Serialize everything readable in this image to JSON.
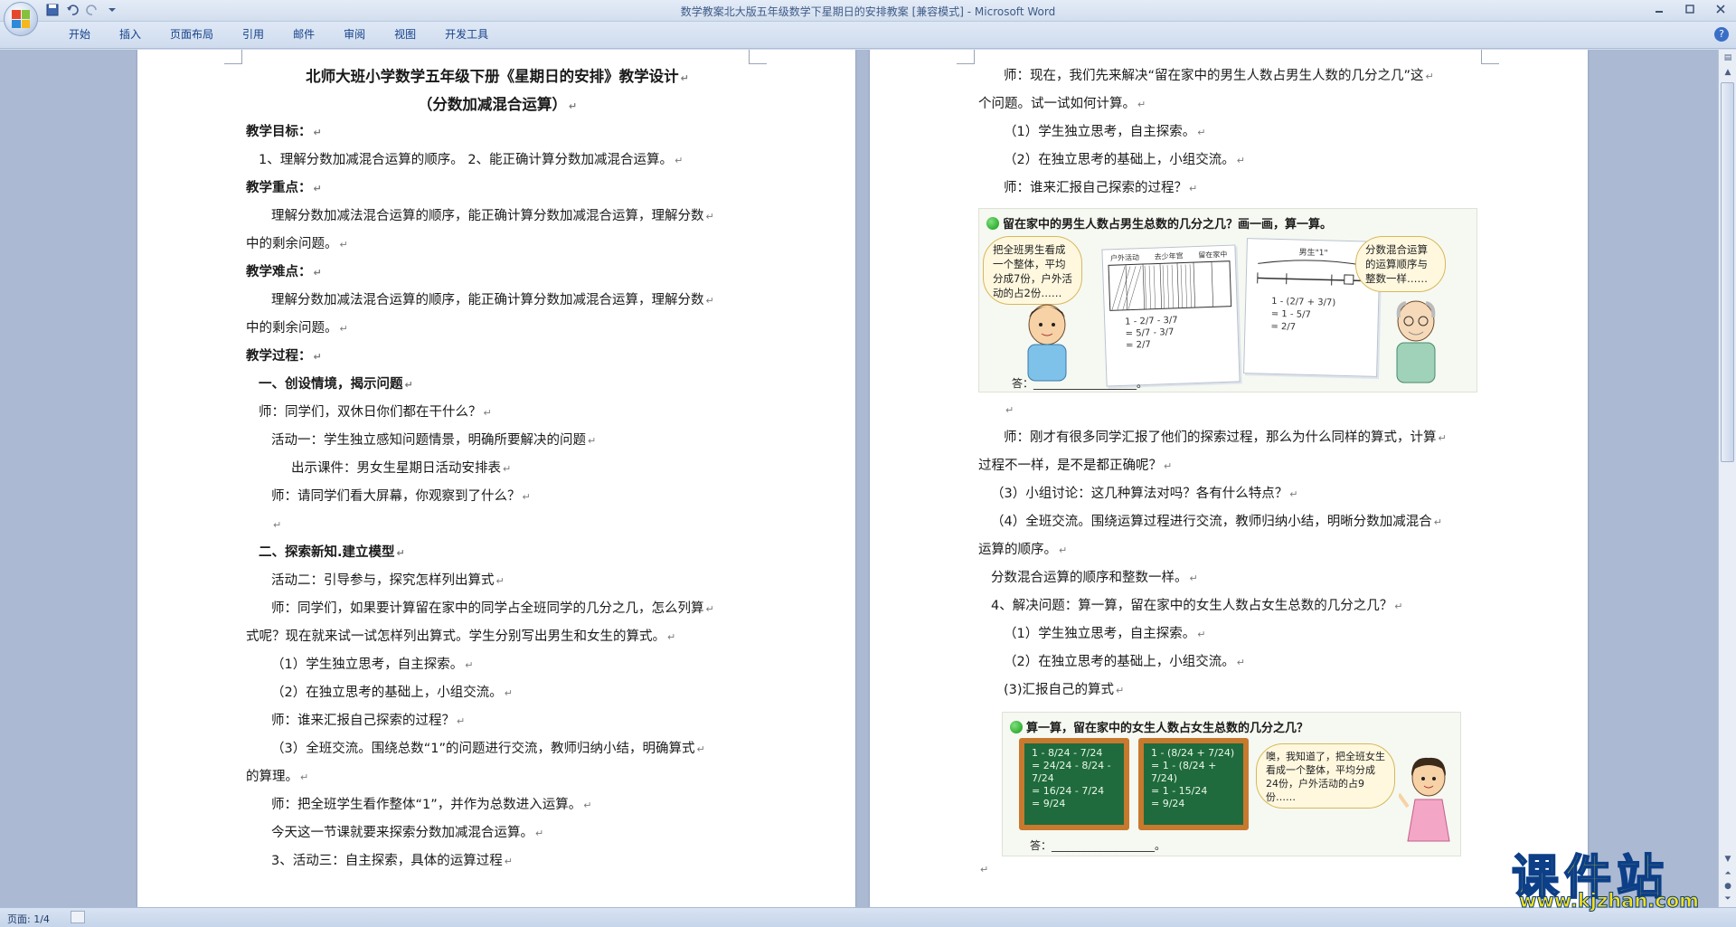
{
  "window": {
    "title": "数学教案北大版五年级数学下星期日的安排教案 [兼容模式] - Microsoft Word"
  },
  "ribbon": {
    "tabs": [
      "开始",
      "插入",
      "页面布局",
      "引用",
      "邮件",
      "审阅",
      "视图",
      "开发工具"
    ]
  },
  "status": {
    "page": "页面: 1/4"
  },
  "doc_left": {
    "title": "北师大班小学数学五年级下册《星期日的安排》教学设计",
    "subtitle": "（分数加减混合运算）",
    "lines": [
      {
        "text": "教学目标：",
        "bold": true,
        "indent": 0
      },
      {
        "text": "1、理解分数加减混合运算的顺序。 2、能正确计算分数加减混合运算。",
        "bold": false,
        "indent": 1
      },
      {
        "text": "教学重点：",
        "bold": true,
        "indent": 0
      },
      {
        "text": "理解分数加减法混合运算的顺序，能正确计算分数加减混合运算，理解分数",
        "bold": false,
        "indent": 2
      },
      {
        "text": "中的剩余问题。",
        "bold": false,
        "indent": 0
      },
      {
        "text": "教学难点：",
        "bold": true,
        "indent": 0
      },
      {
        "text": "理解分数加减法混合运算的顺序，能正确计算分数加减混合运算，理解分数",
        "bold": false,
        "indent": 2
      },
      {
        "text": "中的剩余问题。",
        "bold": false,
        "indent": 0
      },
      {
        "text": "教学过程：",
        "bold": true,
        "indent": 0
      },
      {
        "text": "一、创设情境，揭示问题",
        "bold": true,
        "indent": 1
      },
      {
        "text": "师：同学们，双休日你们都在干什么？",
        "bold": false,
        "indent": 1
      },
      {
        "text": "活动一：学生独立感知问题情景，明确所要解决的问题",
        "bold": false,
        "indent": 2
      },
      {
        "text": "出示课件：男女生星期日活动安排表",
        "bold": false,
        "indent": 3
      },
      {
        "text": "师：请同学们看大屏幕，你观察到了什么？",
        "bold": false,
        "indent": 2
      },
      {
        "text": "",
        "bold": false,
        "indent": 2
      },
      {
        "text": "二、探索新知.建立模型",
        "bold": true,
        "indent": 1
      },
      {
        "text": "活动二：引导参与，探究怎样列出算式",
        "bold": false,
        "indent": 2
      },
      {
        "text": "师：同学们，如果要计算留在家中的同学占全班同学的几分之几，怎么列算",
        "bold": false,
        "indent": 2
      },
      {
        "text": "式呢？现在就来试一试怎样列出算式。学生分别写出男生和女生的算式。",
        "bold": false,
        "indent": 0
      },
      {
        "text": "（1）学生独立思考，自主探索。",
        "bold": false,
        "indent": 2
      },
      {
        "text": "（2）在独立思考的基础上，小组交流。",
        "bold": false,
        "indent": 2
      },
      {
        "text": "师：谁来汇报自己探索的过程？",
        "bold": false,
        "indent": 2
      },
      {
        "text": "（3）全班交流。围绕总数“1”的问题进行交流，教师归纳小结，明确算式",
        "bold": false,
        "indent": 2
      },
      {
        "text": "的算理。",
        "bold": false,
        "indent": 0
      },
      {
        "text": "师：把全班学生看作整体“1”，并作为总数进入运算。",
        "bold": false,
        "indent": 2
      },
      {
        "text": "今天这一节课就要来探索分数加减混合运算。",
        "bold": false,
        "indent": 2
      },
      {
        "text": "3、活动三：自主探索，具体的运算过程",
        "bold": false,
        "indent": 2
      }
    ]
  },
  "doc_right": {
    "lines_top": [
      {
        "text": "师：现在，我们先来解决“留在家中的男生人数占男生人数的几分之几”这",
        "indent": 2
      },
      {
        "text": "个问题。试一试如何计算。",
        "indent": 0
      },
      {
        "text": "（1）学生独立思考，自主探索。",
        "indent": 2
      },
      {
        "text": "（2）在独立思考的基础上，小组交流。",
        "indent": 2
      },
      {
        "text": "师：谁来汇报自己探索的过程？",
        "indent": 2
      }
    ],
    "figure1": {
      "caption": "留在家中的男生人数占男生总数的几分之几？画一画，算一算。",
      "bubble_left": "把全班男生看成一个整体，平均分成7份，户外活动的占2份……",
      "bubble_right": "分数混合运算的运算顺序与整数一样……",
      "sheet_headers": [
        "户外活动",
        "去少年宫",
        "留在家中"
      ],
      "sheet1_formula": [
        "1 - 2/7 - 3/7",
        "= 5/7 - 3/7",
        "= 2/7"
      ],
      "sheet2_title": "男生\"1\"",
      "sheet2_formula": [
        "1 - (2/7 + 3/7)",
        "= 1 - 5/7",
        "= 2/7"
      ],
      "answer": "答：___________________。"
    },
    "lines_mid": [
      {
        "text": "",
        "indent": 2
      },
      {
        "text": "师：刚才有很多同学汇报了他们的探索过程，那么为什么同样的算式，计算",
        "indent": 2
      },
      {
        "text": "过程不一样，是不是都正确呢？",
        "indent": 0
      },
      {
        "text": "（3）小组讨论：这几种算法对吗？各有什么特点？",
        "indent": 1
      },
      {
        "text": "（4）全班交流。围绕运算过程进行交流，教师归纳小结，明晰分数加减混合",
        "indent": 1
      },
      {
        "text": "运算的顺序。",
        "indent": 0
      },
      {
        "text": "分数混合运算的顺序和整数一样。",
        "indent": 1
      },
      {
        "text": "4、解决问题：算一算，留在家中的女生人数占女生总数的几分之几？",
        "indent": 1
      },
      {
        "text": "（1）学生独立思考，自主探索。",
        "indent": 2
      },
      {
        "text": "（2）在独立思考的基础上，小组交流。",
        "indent": 2
      },
      {
        "text": "(3)汇报自己的算式",
        "indent": 2
      }
    ],
    "figure2": {
      "caption": "算一算，留在家中的女生人数占女生总数的几分之几？",
      "board1": [
        "1 - 8/24 - 7/24",
        "= 24/24 - 8/24 - 7/24",
        "= 16/24 - 7/24",
        "= 9/24"
      ],
      "board2": [
        "1 - (8/24 + 7/24)",
        "= 1 - (8/24 + 7/24)",
        "= 1 - 15/24",
        "= 9/24"
      ],
      "bubble": "噢，我知道了，把全班女生看成一个整体，平均分成24份，户外活动的占9份……",
      "answer": "答：___________________。"
    }
  },
  "watermark": {
    "text": "课件站",
    "url": "www.kjzhan.com"
  }
}
